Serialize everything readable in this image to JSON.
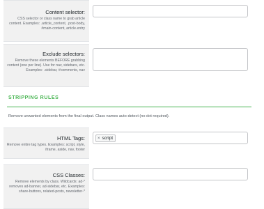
{
  "fields": {
    "content_selector": {
      "label": "Content selector:",
      "description": "CSS selector or class name to grab article content. Examples: .article_content, .post-body, #main-content, article.entry",
      "value": ""
    },
    "exclude_selectors": {
      "label": "Exclude selectors:",
      "description": "Remove these elements BEFORE grabbing content (one per line). Use for nav, sidebars, etc. Examples: .sidebar, #comments, nav",
      "value": ""
    },
    "html_tags": {
      "label": "HTML Tags:",
      "description": "Remove entire tag types. Examples: script, style, iframe, aside, nav, footer",
      "tags": [
        "script"
      ],
      "remove_symbol": "×"
    },
    "css_classes": {
      "label": "CSS Classes:",
      "description": "Remove elements by class. Wildcards: ad-* removes ad-banner, ad-sidebar, etc. Examples: share-buttons, related-posts, newsletter-*",
      "value": ""
    }
  },
  "stripping_rules": {
    "heading": "STRIPPING RULES",
    "description": "Remove unwanted elements from the final output. Class names auto-detect (no dot required)."
  },
  "colors": {
    "accent": "#46b450",
    "label_bg": "#f1f1f1",
    "input_border": "#c3c4c7"
  }
}
